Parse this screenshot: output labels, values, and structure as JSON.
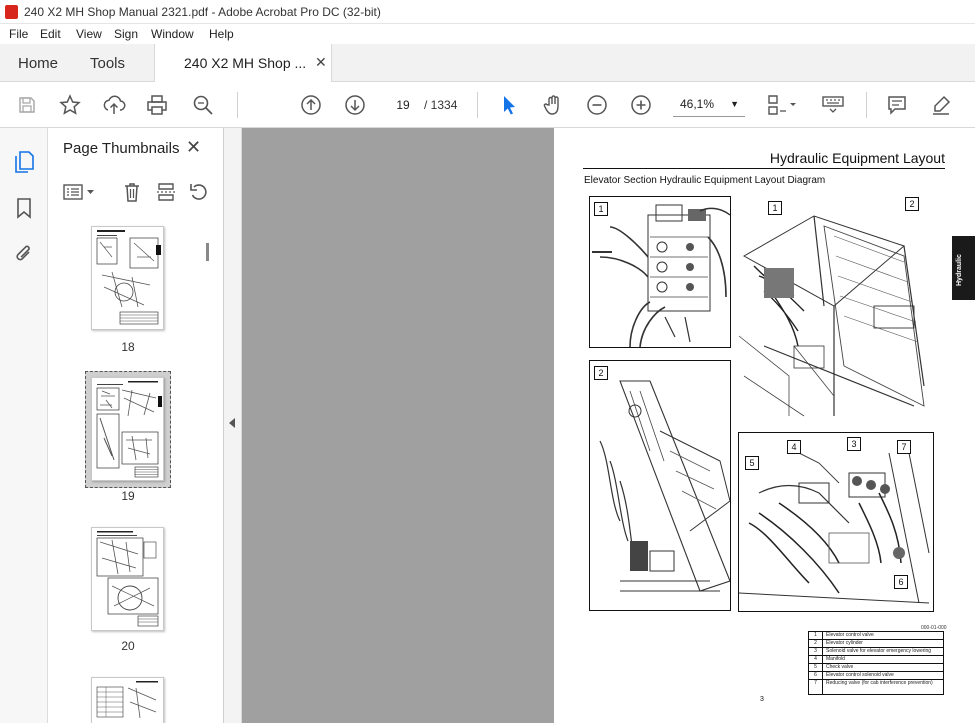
{
  "window": {
    "title": "240 X2 MH Shop Manual 2321.pdf - Adobe Acrobat Pro DC (32-bit)",
    "minimize": "—",
    "maximize": "☐",
    "close": "✕"
  },
  "menu": [
    "File",
    "Edit",
    "View",
    "Sign",
    "Window",
    "Help"
  ],
  "tabs": {
    "home": "Home",
    "tools": "Tools",
    "document": "240 X2 MH Shop ...",
    "document_close": "✕"
  },
  "toolbar": {
    "current_page": "19",
    "total_pages": "/ 1334",
    "zoom": "46,1%",
    "icons": [
      "save-icon",
      "bookmark-star-icon",
      "upload-icon",
      "print-icon",
      "find-icon",
      "page-up-icon",
      "page-down-icon",
      "select-arrow-icon",
      "hand-icon",
      "zoom-out-icon",
      "zoom-in-icon",
      "page-layout-icon",
      "keyboard-icon",
      "comment-icon",
      "highlight-pen-icon"
    ]
  },
  "thumbnails_panel": {
    "title": "Page Thumbnails",
    "close": "✕",
    "pages": [
      {
        "label": "18",
        "selected": false
      },
      {
        "label": "19",
        "selected": true
      },
      {
        "label": "20",
        "selected": false
      }
    ]
  },
  "page": {
    "title": "Hydraulic Equipment Layout",
    "subtitle": "Elevator Section Hydraulic Equipment Layout Diagram",
    "side_tab": "Hydraulic",
    "figure_code": "000-01-000",
    "page_number": "3",
    "callouts": [
      "1",
      "1",
      "2",
      "2",
      "4",
      "3",
      "7",
      "5",
      "6"
    ],
    "legend": [
      {
        "num": "1",
        "desc": "Elevator control valve"
      },
      {
        "num": "2",
        "desc": "Elevator cylinder"
      },
      {
        "num": "3",
        "desc": "Solenoid valve for elevator emergency lowering"
      },
      {
        "num": "4",
        "desc": "Manifold"
      },
      {
        "num": "5",
        "desc": "Check valve"
      },
      {
        "num": "6",
        "desc": "Elevator control solenoid valve"
      },
      {
        "num": "7",
        "desc": "Reducing valve (for cab interference prevention)"
      }
    ]
  },
  "colors": {
    "accent_blue": "#1473e6",
    "doc_background": "#a0a0a0",
    "app_icon": "#d7261e"
  }
}
